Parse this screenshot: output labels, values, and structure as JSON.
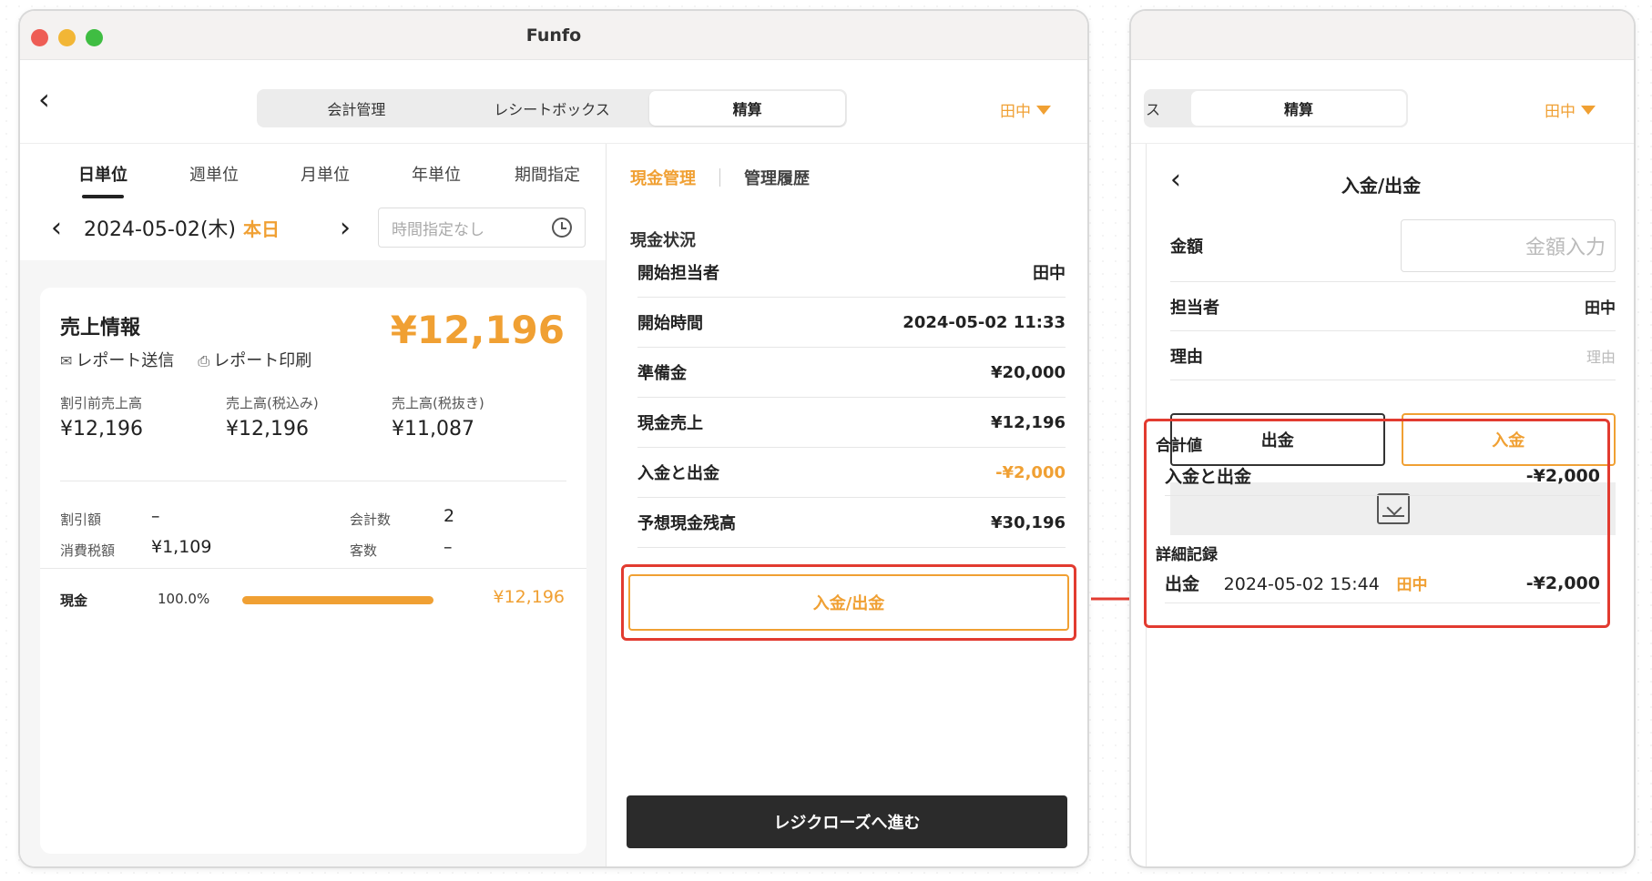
{
  "window": {
    "title": "Funfo"
  },
  "nav": {
    "segments": [
      "会計管理",
      "レシートボックス",
      "精算"
    ],
    "active_segment": "精算",
    "user": "田中"
  },
  "left": {
    "periods": [
      "日単位",
      "週単位",
      "月単位",
      "年単位",
      "期間指定"
    ],
    "active_period": "日単位",
    "date": "2024-05-02(木)",
    "today": "本日",
    "time_placeholder": "時間指定なし",
    "sales": {
      "title": "売上情報",
      "total": "¥12,196",
      "send_report": "レポート送信",
      "print_report": "レポート印刷",
      "stats": [
        {
          "label": "割引前売上高",
          "value": "¥12,196"
        },
        {
          "label": "売上高(税込み)",
          "value": "¥12,196"
        },
        {
          "label": "売上高(税抜き)",
          "value": "¥11,087"
        }
      ],
      "discount_label": "割引額",
      "discount_value": "–",
      "tax_label": "消費税額",
      "tax_value": "¥1,109",
      "count_label": "会計数",
      "count_value": "2",
      "guests_label": "客数",
      "guests_value": "–",
      "payment": {
        "method": "現金",
        "percent": "100.0%",
        "fraction": 1.0,
        "amount": "¥12,196"
      }
    }
  },
  "right": {
    "tabs": [
      "現金管理",
      "管理履歴"
    ],
    "section": "現金状況",
    "rows": [
      {
        "label": "開始担当者",
        "value": "田中"
      },
      {
        "label": "開始時間",
        "value": "2024-05-02 11:33"
      },
      {
        "label": "準備金",
        "value": "¥20,000"
      },
      {
        "label": "現金売上",
        "value": "¥12,196"
      },
      {
        "label": "入金と出金",
        "value": "-¥2,000"
      },
      {
        "label": "予想現金残高",
        "value": "¥30,196"
      }
    ],
    "inout_button": "入金/出金",
    "close_button": "レジクローズへ進む"
  },
  "second": {
    "seg_partial": "ス",
    "seg_active": "精算",
    "user": "田中",
    "header": "入金/出金",
    "amount_label": "金額",
    "amount_placeholder": "金額入力",
    "person_label": "担当者",
    "person_value": "田中",
    "reason_label": "理由",
    "reason_placeholder": "理由",
    "out_button": "出金",
    "in_button": "入金",
    "total_heading": "合計値",
    "total_label": "入金と出金",
    "total_value": "-¥2,000",
    "detail_heading": "詳細記録",
    "detail": {
      "type": "出金",
      "time": "2024-05-02 15:44",
      "person": "田中",
      "amount": "-¥2,000"
    }
  },
  "colors": {
    "accent": "#f0a033",
    "highlight": "#e23b30",
    "dark": "#2b2b2b"
  }
}
